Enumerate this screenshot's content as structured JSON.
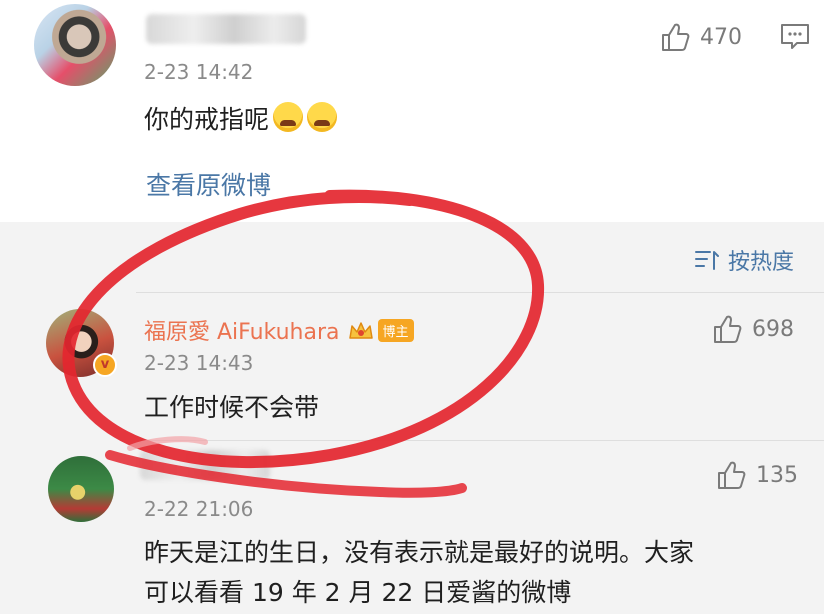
{
  "comment1": {
    "time": "2-23 14:42",
    "text": "你的戒指呢",
    "likes": "470",
    "view_original": "查看原微博"
  },
  "sort": {
    "label": "按热度"
  },
  "comment2": {
    "name": "福原愛 AiFukuhara",
    "badge": "博主",
    "verified_mark": "v",
    "time": "2-23 14:43",
    "text": "工作时候不会带",
    "likes": "698"
  },
  "comment3": {
    "time": "2-22 21:06",
    "text_line1": "昨天是江的生日，没有表示就是最好的说明。大家",
    "text_line2": "可以看看 19 年 2 月 22 日爱酱的微博",
    "likes": "135"
  },
  "colors": {
    "link": "#4a77a6",
    "name": "#eb7350",
    "annotation_red": "#e4262f",
    "badge": "#f6a623"
  }
}
